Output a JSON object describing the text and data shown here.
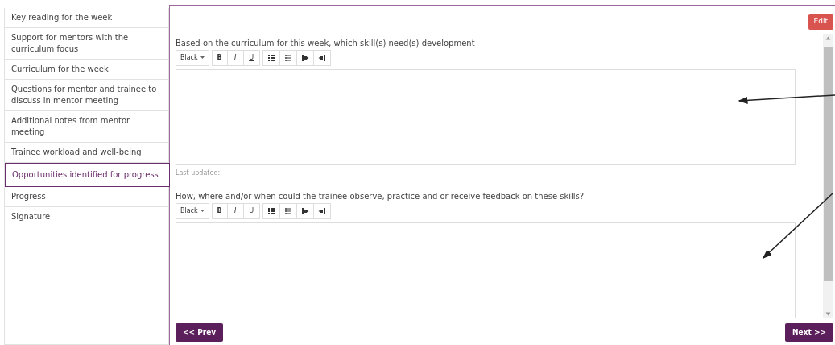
{
  "sidebar": {
    "items": [
      {
        "label": "Key reading for the week",
        "selected": false
      },
      {
        "label": "Support for mentors with the curriculum focus",
        "selected": false
      },
      {
        "label": "Curriculum for the week",
        "selected": false
      },
      {
        "label": "Questions for mentor and trainee to discuss in mentor meeting",
        "selected": false
      },
      {
        "label": "Additional notes from mentor meeting",
        "selected": false
      },
      {
        "label": "Trainee workload and well-being",
        "selected": false
      },
      {
        "label": "Opportunities identified for progress",
        "selected": true
      },
      {
        "label": "Progress",
        "selected": false
      },
      {
        "label": "Signature",
        "selected": false
      }
    ]
  },
  "edit_button": "Edit",
  "questions": [
    {
      "label": "Based on the curriculum for this week, which skill(s) need(s) development",
      "color_menu": "Black",
      "format_buttons": [
        "B",
        "I",
        "U"
      ],
      "last_updated": "Last updated: --"
    },
    {
      "label": "How, where and/or when could the trainee observe, practice and or receive feedback on these skills?",
      "color_menu": "Black",
      "format_buttons": [
        "B",
        "I",
        "U"
      ]
    }
  ],
  "nav": {
    "prev": "<< Prev",
    "next": "Next >>"
  }
}
